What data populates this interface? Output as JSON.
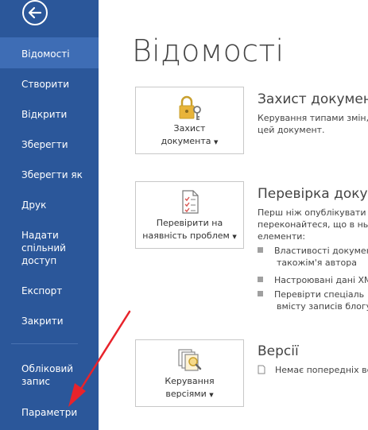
{
  "sidebar": {
    "items": [
      {
        "label": "Відомості",
        "active": true
      },
      {
        "label": "Створити"
      },
      {
        "label": "Відкрити"
      },
      {
        "label": "Зберегти"
      },
      {
        "label": "Зберегти як"
      },
      {
        "label": "Друк"
      },
      {
        "label": "Надати спільний доступ",
        "lines": [
          "Надати",
          "спільний",
          "доступ"
        ]
      },
      {
        "label": "Експорт"
      },
      {
        "label": "Закрити"
      },
      {
        "label": "Обліковий запис",
        "lines": [
          "Обліковий",
          "запис"
        ]
      },
      {
        "label": "Параметри"
      }
    ]
  },
  "page": {
    "title": "Відомості"
  },
  "sections": {
    "protect": {
      "button": {
        "line1": "Захист",
        "line2": "документа"
      },
      "title": "Захист документ",
      "desc": [
        "Керування типами змін, я",
        "цей документ."
      ]
    },
    "inspect": {
      "button": {
        "line1": "Перевірити на",
        "line2": "наявність проблем"
      },
      "title": "Перевірка докум",
      "desc": [
        "Перш ніж опублікувати ц",
        "переконайтеся, що в ньо",
        "елементи:"
      ],
      "bullets": [
        {
          "line1": "Властивості докумен",
          "line2": "такожім'я автора"
        },
        {
          "line1": "Настроювані дані XM"
        },
        {
          "line1": "Перевірти спеціаль",
          "line2": "вмісту записів блогу"
        }
      ]
    },
    "versions": {
      "button": {
        "line1": "Керування",
        "line2": "версіями"
      },
      "title": "Версії",
      "desc": "Немає попередніх ве"
    }
  },
  "colors": {
    "sidebar": "#2b579a",
    "sidebar_active": "#3e6db5",
    "arrow": "#e8232b",
    "lock": "#e8b43a"
  }
}
